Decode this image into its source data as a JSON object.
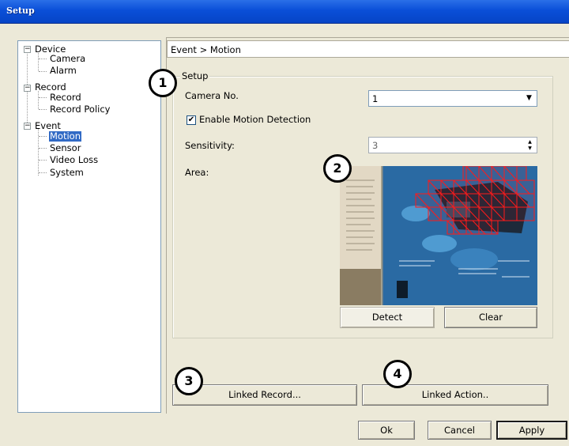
{
  "window": {
    "title": "Setup"
  },
  "tree": {
    "items": [
      {
        "label": "Device",
        "expander": "−"
      },
      {
        "label": "Camera"
      },
      {
        "label": "Alarm"
      },
      {
        "label": "Record",
        "expander": "−"
      },
      {
        "label": "Record"
      },
      {
        "label": "Record Policy"
      },
      {
        "label": "Event",
        "expander": "−"
      },
      {
        "label": "Motion",
        "selected": true
      },
      {
        "label": "Sensor"
      },
      {
        "label": "Video Loss"
      },
      {
        "label": "System"
      }
    ]
  },
  "breadcrumb": "Event > Motion",
  "setup": {
    "legend": "Setup",
    "camera_label": "Camera No.",
    "camera_value": "1",
    "enable_label": "Enable Motion Detection",
    "enable_checked": true,
    "sensitivity_label": "Sensitivity:",
    "sensitivity_value": "3",
    "area_label": "Area:",
    "detect_label": "Detect",
    "clear_label": "Clear"
  },
  "buttons": {
    "linked_record": "Linked Record...",
    "linked_action": "Linked Action..",
    "ok": "Ok",
    "cancel": "Cancel",
    "apply": "Apply"
  },
  "callouts": [
    "1",
    "2",
    "3",
    "4"
  ],
  "colors": {
    "title_bar": "#0a4fd8",
    "selection": "#316ac5",
    "motion_grid": "#ff0000"
  }
}
